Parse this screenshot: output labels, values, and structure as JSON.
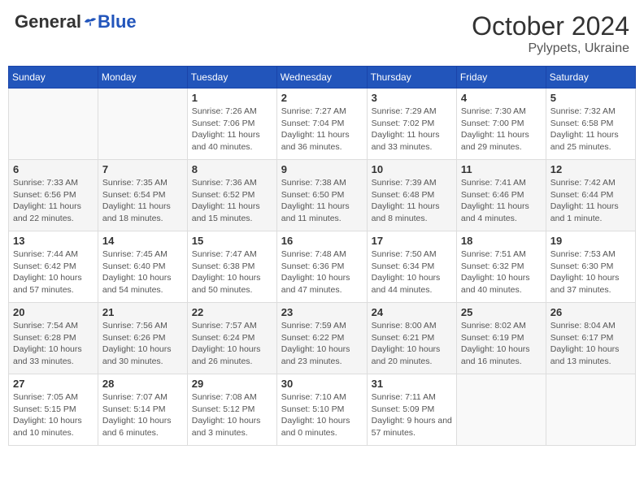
{
  "header": {
    "logo_general": "General",
    "logo_blue": "Blue",
    "month": "October 2024",
    "location": "Pylypets, Ukraine"
  },
  "weekdays": [
    "Sunday",
    "Monday",
    "Tuesday",
    "Wednesday",
    "Thursday",
    "Friday",
    "Saturday"
  ],
  "weeks": [
    [
      {
        "day": "",
        "info": ""
      },
      {
        "day": "",
        "info": ""
      },
      {
        "day": "1",
        "info": "Sunrise: 7:26 AM\nSunset: 7:06 PM\nDaylight: 11 hours and 40 minutes."
      },
      {
        "day": "2",
        "info": "Sunrise: 7:27 AM\nSunset: 7:04 PM\nDaylight: 11 hours and 36 minutes."
      },
      {
        "day": "3",
        "info": "Sunrise: 7:29 AM\nSunset: 7:02 PM\nDaylight: 11 hours and 33 minutes."
      },
      {
        "day": "4",
        "info": "Sunrise: 7:30 AM\nSunset: 7:00 PM\nDaylight: 11 hours and 29 minutes."
      },
      {
        "day": "5",
        "info": "Sunrise: 7:32 AM\nSunset: 6:58 PM\nDaylight: 11 hours and 25 minutes."
      }
    ],
    [
      {
        "day": "6",
        "info": "Sunrise: 7:33 AM\nSunset: 6:56 PM\nDaylight: 11 hours and 22 minutes."
      },
      {
        "day": "7",
        "info": "Sunrise: 7:35 AM\nSunset: 6:54 PM\nDaylight: 11 hours and 18 minutes."
      },
      {
        "day": "8",
        "info": "Sunrise: 7:36 AM\nSunset: 6:52 PM\nDaylight: 11 hours and 15 minutes."
      },
      {
        "day": "9",
        "info": "Sunrise: 7:38 AM\nSunset: 6:50 PM\nDaylight: 11 hours and 11 minutes."
      },
      {
        "day": "10",
        "info": "Sunrise: 7:39 AM\nSunset: 6:48 PM\nDaylight: 11 hours and 8 minutes."
      },
      {
        "day": "11",
        "info": "Sunrise: 7:41 AM\nSunset: 6:46 PM\nDaylight: 11 hours and 4 minutes."
      },
      {
        "day": "12",
        "info": "Sunrise: 7:42 AM\nSunset: 6:44 PM\nDaylight: 11 hours and 1 minute."
      }
    ],
    [
      {
        "day": "13",
        "info": "Sunrise: 7:44 AM\nSunset: 6:42 PM\nDaylight: 10 hours and 57 minutes."
      },
      {
        "day": "14",
        "info": "Sunrise: 7:45 AM\nSunset: 6:40 PM\nDaylight: 10 hours and 54 minutes."
      },
      {
        "day": "15",
        "info": "Sunrise: 7:47 AM\nSunset: 6:38 PM\nDaylight: 10 hours and 50 minutes."
      },
      {
        "day": "16",
        "info": "Sunrise: 7:48 AM\nSunset: 6:36 PM\nDaylight: 10 hours and 47 minutes."
      },
      {
        "day": "17",
        "info": "Sunrise: 7:50 AM\nSunset: 6:34 PM\nDaylight: 10 hours and 44 minutes."
      },
      {
        "day": "18",
        "info": "Sunrise: 7:51 AM\nSunset: 6:32 PM\nDaylight: 10 hours and 40 minutes."
      },
      {
        "day": "19",
        "info": "Sunrise: 7:53 AM\nSunset: 6:30 PM\nDaylight: 10 hours and 37 minutes."
      }
    ],
    [
      {
        "day": "20",
        "info": "Sunrise: 7:54 AM\nSunset: 6:28 PM\nDaylight: 10 hours and 33 minutes."
      },
      {
        "day": "21",
        "info": "Sunrise: 7:56 AM\nSunset: 6:26 PM\nDaylight: 10 hours and 30 minutes."
      },
      {
        "day": "22",
        "info": "Sunrise: 7:57 AM\nSunset: 6:24 PM\nDaylight: 10 hours and 26 minutes."
      },
      {
        "day": "23",
        "info": "Sunrise: 7:59 AM\nSunset: 6:22 PM\nDaylight: 10 hours and 23 minutes."
      },
      {
        "day": "24",
        "info": "Sunrise: 8:00 AM\nSunset: 6:21 PM\nDaylight: 10 hours and 20 minutes."
      },
      {
        "day": "25",
        "info": "Sunrise: 8:02 AM\nSunset: 6:19 PM\nDaylight: 10 hours and 16 minutes."
      },
      {
        "day": "26",
        "info": "Sunrise: 8:04 AM\nSunset: 6:17 PM\nDaylight: 10 hours and 13 minutes."
      }
    ],
    [
      {
        "day": "27",
        "info": "Sunrise: 7:05 AM\nSunset: 5:15 PM\nDaylight: 10 hours and 10 minutes."
      },
      {
        "day": "28",
        "info": "Sunrise: 7:07 AM\nSunset: 5:14 PM\nDaylight: 10 hours and 6 minutes."
      },
      {
        "day": "29",
        "info": "Sunrise: 7:08 AM\nSunset: 5:12 PM\nDaylight: 10 hours and 3 minutes."
      },
      {
        "day": "30",
        "info": "Sunrise: 7:10 AM\nSunset: 5:10 PM\nDaylight: 10 hours and 0 minutes."
      },
      {
        "day": "31",
        "info": "Sunrise: 7:11 AM\nSunset: 5:09 PM\nDaylight: 9 hours and 57 minutes."
      },
      {
        "day": "",
        "info": ""
      },
      {
        "day": "",
        "info": ""
      }
    ]
  ]
}
